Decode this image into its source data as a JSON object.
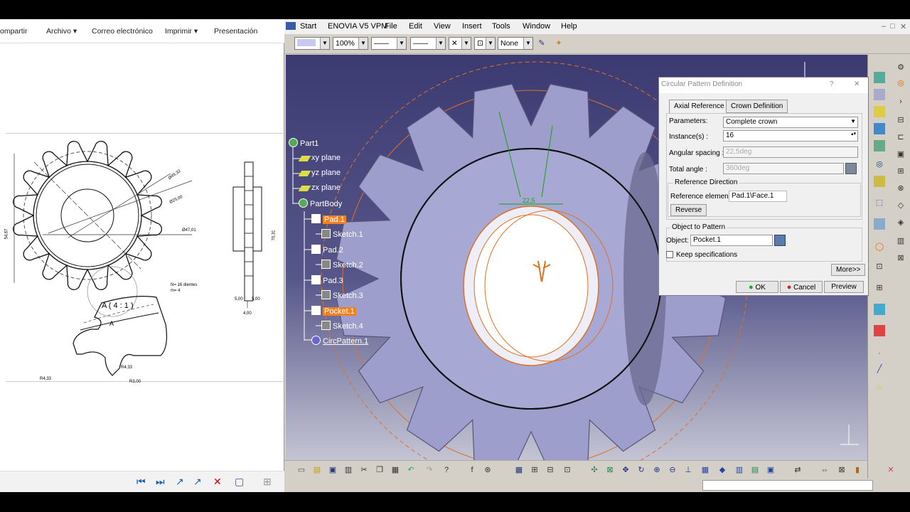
{
  "left_app": {
    "menu": [
      "ompartir",
      "Archivo ▾",
      "Correo electrónico",
      "Imprimir ▾",
      "Presentación"
    ],
    "drawing_labels": {
      "d1": "Ø49,32",
      "d2": "Ø25,00",
      "d3": "Ø47,01",
      "d4": "54,67",
      "d5": "70,31",
      "d6": "5,00",
      "d7": "5,00",
      "d8": "4,00",
      "teeth": "N= 16 dientes",
      "module": "m= 4",
      "detail": "A ( 4 : 1 )",
      "detail_mark": "A",
      "r1": "R4,33",
      "r2": "R4,33",
      "r3": "R3,00"
    },
    "nav_icons": [
      "⏮",
      "⏭",
      "↗",
      "✕",
      "▢",
      "⊞"
    ]
  },
  "catia": {
    "menu": [
      "Start",
      "ENOVIA V5 VPM",
      "File",
      "Edit",
      "View",
      "Insert",
      "Tools",
      "Window",
      "Help"
    ],
    "window_controls": [
      "–",
      "□",
      "✕"
    ],
    "toolbar": {
      "zoom": "100%",
      "none": "None"
    },
    "tree": [
      {
        "label": "Part1"
      },
      {
        "label": "xy plane"
      },
      {
        "label": "yz plane"
      },
      {
        "label": "zx plane"
      },
      {
        "label": "PartBody"
      },
      {
        "label": "Pad.1"
      },
      {
        "label": "Sketch.1"
      },
      {
        "label": "Pad.2"
      },
      {
        "label": "Sketch.2"
      },
      {
        "label": "Pad.3"
      },
      {
        "label": "Sketch.3"
      },
      {
        "label": "Pocket.1"
      },
      {
        "label": "Sketch.4"
      },
      {
        "label": "CircPattern.1"
      }
    ],
    "viewport_annotation": "22,5",
    "dialog": {
      "title": "Circular Pattern Definition",
      "help": "?",
      "close": "✕",
      "tabs": [
        "Axial Reference",
        "Crown Definition"
      ],
      "parameters_label": "Parameters:",
      "parameters_value": "Complete crown",
      "instances_label": "Instance(s) :",
      "instances_value": "16",
      "spacing_label": "Angular spacing :",
      "spacing_value": "22,5deg",
      "total_label": "Total angle :",
      "total_value": "360deg",
      "ref_dir_label": "Reference Direction",
      "ref_elem_label": "Reference element:",
      "ref_elem_value": "Pad.1\\Face.1",
      "reverse": "Reverse",
      "obj_group": "Object to Pattern",
      "object_label": "Object:",
      "object_value": "Pocket.1",
      "keep_label": "Keep specifications",
      "more": "More>>",
      "ok": "OK",
      "cancel": "Cancel",
      "preview": "Preview"
    },
    "colors": {
      "viewport": "#4a4a84",
      "highlight": "#f08020"
    }
  }
}
